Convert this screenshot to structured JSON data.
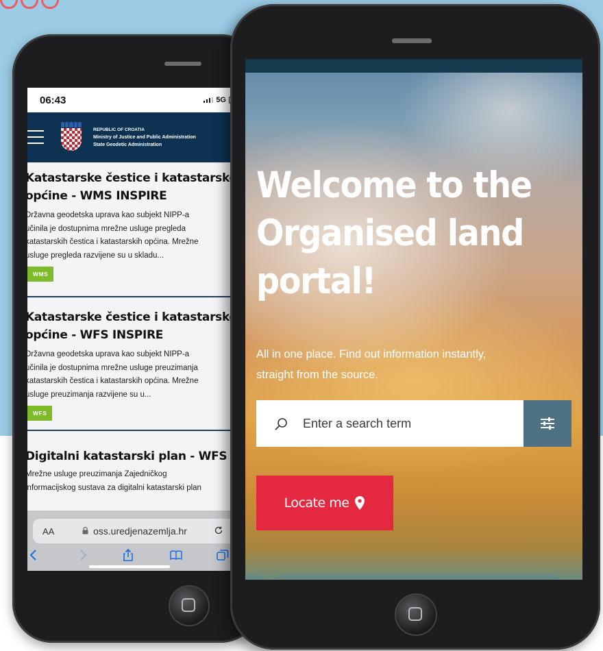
{
  "colors": {
    "background_top": "#9ccbe6",
    "header_navy": "#0d3251",
    "tag_green": "#7dbb2a",
    "locate_red": "#e4283f",
    "filter_slate": "#4f7184",
    "brand_coral": "#ef5a5f"
  },
  "left_phone": {
    "status": {
      "time": "06:43",
      "network": "5G"
    },
    "header": {
      "org_line1": "REPUBLIC OF CROATIA",
      "org_line2": "Ministry of Justice and Public Administration",
      "org_line3": "State Geodetic Administration"
    },
    "articles": [
      {
        "title_lines": [
          "Katastarske čestice i katastarske",
          "općine - WMS INSPIRE"
        ],
        "text_lines": [
          "Državna geodetska uprava kao subjekt NIPP-a",
          "učinila je dostupnima mrežne usluge pregleda",
          "katastarskih čestica i katastarskih općina. Mrežne",
          "usluge pregleda razvijene su u skladu..."
        ],
        "tag": "WMS"
      },
      {
        "title_lines": [
          "Katastarske čestice i katastarske",
          "općine - WFS INSPIRE"
        ],
        "text_lines": [
          "Državna geodetska uprava kao subjekt NIPP-a",
          "učinila je dostupnima mrežne usluge preuzimanja",
          "katastarskih čestica i katastarskih općina. Mrežne",
          "usluge preuzimanja razvijene su u..."
        ],
        "tag": "WFS"
      },
      {
        "title_lines": [
          "Digitalni katastarski plan - WFS"
        ],
        "text_lines": [
          "Mrežne usluge preuzimanja Zajedničkog",
          "informacijskog sustava za digitalni katastarski plan"
        ]
      }
    ],
    "browser": {
      "text_size_label": "AA",
      "url": "oss.uredjenazemlja.hr"
    }
  },
  "right_phone": {
    "headline_lines": [
      "Welcome to the",
      "Organised land",
      "portal!"
    ],
    "subtitle_lines": [
      "All in one place. Find out information instantly,",
      "straight from the source."
    ],
    "search": {
      "placeholder": "Enter a search term"
    },
    "locate_label": "Locate me"
  }
}
